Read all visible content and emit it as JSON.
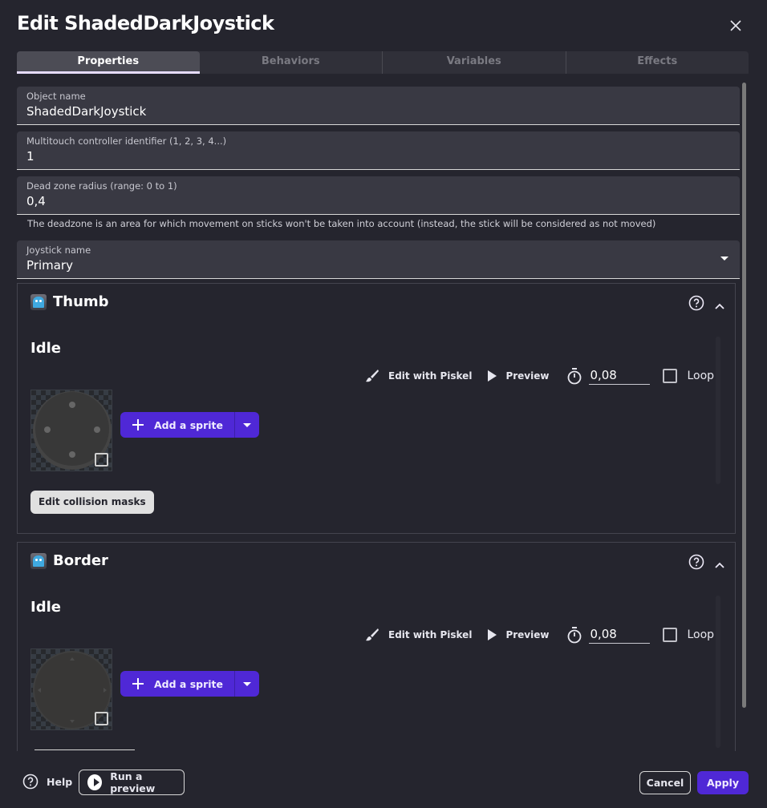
{
  "dialog": {
    "title": "Edit ShadedDarkJoystick",
    "close_icon": "close-icon"
  },
  "tabs": [
    {
      "label": "Properties",
      "active": true
    },
    {
      "label": "Behaviors",
      "active": false
    },
    {
      "label": "Variables",
      "active": false
    },
    {
      "label": "Effects",
      "active": false
    }
  ],
  "fields": {
    "object_name": {
      "label": "Object name",
      "value": "ShadedDarkJoystick"
    },
    "multitouch_id": {
      "label": "Multitouch controller identifier (1, 2, 3, 4...)",
      "value": "1"
    },
    "dead_zone": {
      "label": "Dead zone radius (range: 0 to 1)",
      "value": "0,4",
      "helper": "The deadzone is an area for which movement on sticks won't be taken into account (instead, the stick will be considered as not moved)"
    },
    "joystick_name": {
      "label": "Joystick name",
      "value": "Primary"
    }
  },
  "panels": [
    {
      "title": "Thumb",
      "icon": "ghost-object-icon",
      "animation": {
        "name": "Idle",
        "edit_with_piskel": "Edit with Piskel",
        "preview": "Preview",
        "frame_duration": "0,08",
        "loop_label": "Loop",
        "loop_checked": false,
        "add_sprite": "Add a sprite",
        "edit_collision_masks": "Edit collision masks"
      }
    },
    {
      "title": "Border",
      "icon": "ghost-object-icon",
      "animation": {
        "name": "Idle",
        "edit_with_piskel": "Edit with Piskel",
        "preview": "Preview",
        "frame_duration": "0,08",
        "loop_label": "Loop",
        "loop_checked": false,
        "add_sprite": "Add a sprite"
      }
    }
  ],
  "footer": {
    "help": "Help",
    "run_preview": "Run a preview",
    "cancel": "Cancel",
    "apply": "Apply"
  },
  "colors": {
    "background": "#25252e",
    "field": "#393943",
    "accent": "#4f28d6",
    "tab_indicator": "#e6dcff"
  }
}
